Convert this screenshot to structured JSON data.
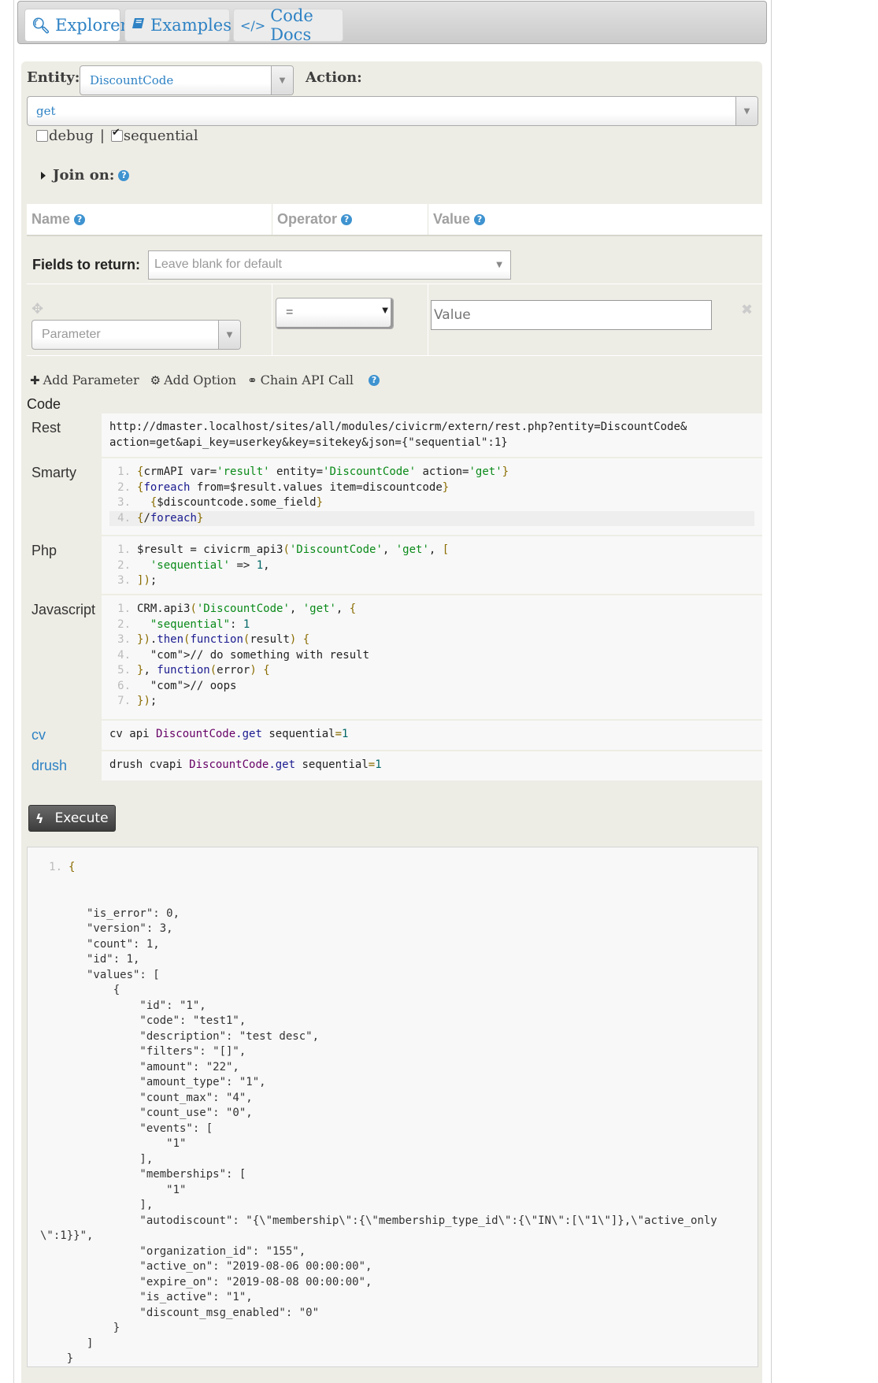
{
  "tabs": [
    {
      "label": "Explorer",
      "icon": "search-icon",
      "active": true
    },
    {
      "label": "Examples",
      "icon": "book-icon",
      "active": false
    },
    {
      "label": "Code Docs",
      "icon": "code-icon",
      "active": false
    }
  ],
  "form": {
    "entity_label": "Entity:",
    "entity_value": "DiscountCode",
    "action_label": "Action:",
    "action_value": "get",
    "debug_label": "debug",
    "debug_checked": false,
    "separator": "|",
    "sequential_label": "sequential",
    "sequential_checked": true,
    "join_label": "Join on:"
  },
  "params": {
    "headers": {
      "name": "Name",
      "operator": "Operator",
      "value": "Value"
    },
    "fields_label": "Fields to return:",
    "fields_placeholder": "Leave blank for default",
    "parameter_placeholder": "Parameter",
    "operator_value": "=",
    "value_placeholder": "Value"
  },
  "actions": {
    "add_parameter": "Add Parameter",
    "add_option": "Add Option",
    "chain_api_call": "Chain API Call"
  },
  "code": {
    "section_label": "Code",
    "rest_label": "Rest",
    "rest_line1": "http://dmaster.localhost/sites/all/modules/civicrm/extern/rest.php?entity=DiscountCode&",
    "rest_line2": "action=get&api_key=userkey&key=sitekey&json={\"sequential\":1}",
    "smarty_label": "Smarty",
    "php_label": "Php",
    "javascript_label": "Javascript",
    "cv_label": "cv",
    "cv_cmd": "cv api",
    "cv_entity": "DiscountCode",
    "cv_action": ".get",
    "cv_param": " sequential",
    "cv_eq": "=",
    "cv_val": "1",
    "drush_label": "drush",
    "drush_cmd": "drush cvapi",
    "smarty_lines": [
      "{crmAPI var='result' entity='DiscountCode' action='get'}",
      "{foreach from=$result.values item=discountcode}",
      "  {$discountcode.some_field}",
      "{/foreach}"
    ],
    "php_lines": [
      "$result = civicrm_api3('DiscountCode', 'get', [",
      "  'sequential' => 1,",
      "]);"
    ],
    "javascript_lines": [
      "CRM.api3('DiscountCode', 'get', {",
      "  \"sequential\": 1",
      "}).then(function(result) {",
      "  // do something with result",
      "}, function(error) {",
      "  // oops",
      "});"
    ]
  },
  "execute_label": "Execute",
  "result": {
    "line_number": "1.",
    "text": "{\n\n\n   \"is_error\": 0,\n   \"version\": 3,\n   \"count\": 1,\n   \"id\": 1,\n   \"values\": [\n       {\n           \"id\": \"1\",\n           \"code\": \"test1\",\n           \"description\": \"test desc\",\n           \"filters\": \"[]\",\n           \"amount\": \"22\",\n           \"amount_type\": \"1\",\n           \"count_max\": \"4\",\n           \"count_use\": \"0\",\n           \"events\": [\n               \"1\"\n           ],\n           \"memberships\": [\n               \"1\"\n           ],\n           \"autodiscount\": \"{\\\"membership\\\":{\\\"membership_type_id\\\":{\\\"IN\\\":[\\\"1\\\"]},\\\"active_only\n\\\":1}}\",\n           \"organization_id\": \"155\",\n           \"active_on\": \"2019-08-06 00:00:00\",\n           \"expire_on\": \"2019-08-08 00:00:00\",\n           \"is_active\": \"1\",\n           \"discount_msg_enabled\": \"0\"\n       }\n   ]\n}"
  }
}
